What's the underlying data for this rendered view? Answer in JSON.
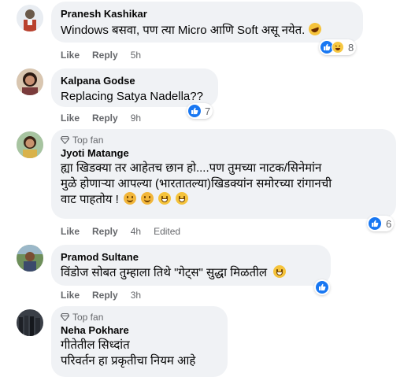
{
  "comments": [
    {
      "name": "Pranesh Kashikar",
      "text": "Windows बसवा, पण त्या Micro आणि Soft असू नयेत.",
      "like": "Like",
      "reply": "Reply",
      "time": "5h",
      "reactions": [
        "like",
        "haha"
      ],
      "reaction_count": "8"
    },
    {
      "name": "Kalpana Godse",
      "text": "Replacing Satya Nadella??",
      "like": "Like",
      "reply": "Reply",
      "time": "9h",
      "reactions": [
        "like"
      ],
      "reaction_count": "7"
    },
    {
      "badge": "Top fan",
      "name": "Jyoti Matange",
      "text_lines": [
        "ह्या खिडक्या तर आहेतच छान हो....पण तुमच्या नाटक/सिनेमांन",
        "मुळे होणाऱ्या आपल्या (भारतातल्या)खिडक्यांन समोरच्या रांगानची",
        "वाट पाहतोय !"
      ],
      "like": "Like",
      "reply": "Reply",
      "time": "4h",
      "edited": "Edited",
      "reactions": [
        "like"
      ],
      "reaction_count": "6"
    },
    {
      "name": "Pramod Sultane",
      "text": "विंडोज सोबत तुम्हाला तिथे \"गेट्स\" सुद्धा मिळतील",
      "like": "Like",
      "reply": "Reply",
      "time": "3h",
      "reactions": [
        "like"
      ]
    },
    {
      "badge": "Top fan",
      "name": "Neha Pokhare",
      "text_lines": [
        "गीतेतील सिध्दांत",
        "परिवर्तन हा प्रकृतीचा नियम आहे"
      ]
    }
  ],
  "colors": {
    "like_blue": "#1877f2",
    "bubble": "#f0f2f5",
    "meta": "#65676b"
  }
}
